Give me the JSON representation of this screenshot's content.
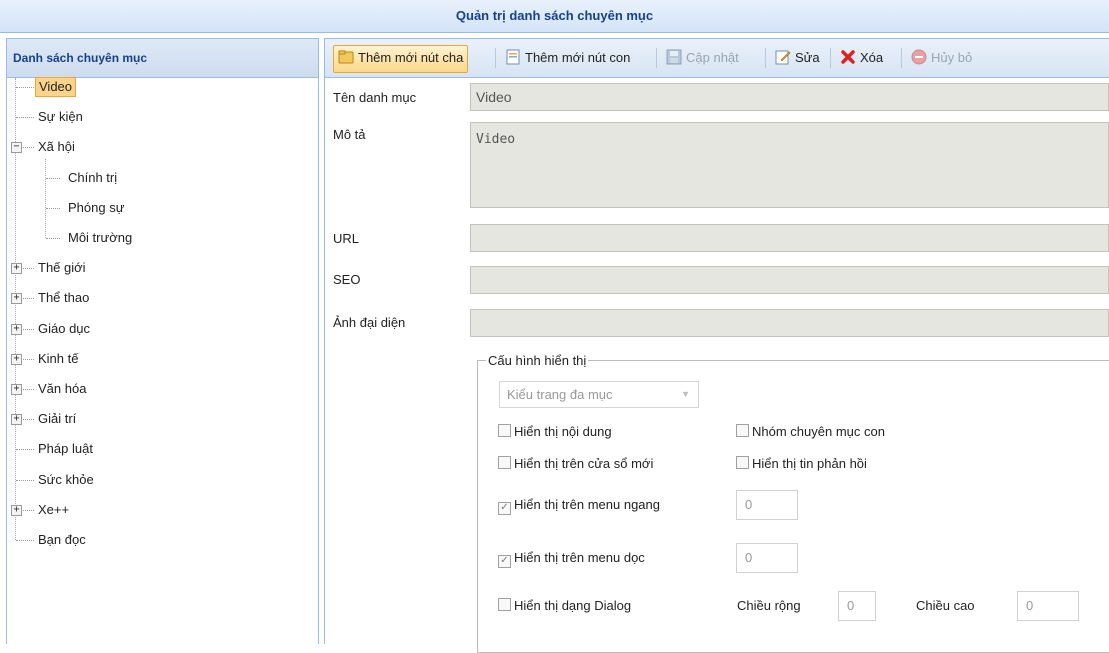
{
  "window_title": "Quản trị danh sách chuyên mục",
  "sidebar": {
    "title": "Danh sách chuyên mục",
    "items": [
      {
        "label": "Video",
        "level": 0,
        "selected": true,
        "expander": "none"
      },
      {
        "label": "Sự kiện",
        "level": 0,
        "expander": "none"
      },
      {
        "label": "Xã hội",
        "level": 0,
        "expander": "collapse"
      },
      {
        "label": "Chính trị",
        "level": 1,
        "expander": "none"
      },
      {
        "label": "Phóng sự",
        "level": 1,
        "expander": "none"
      },
      {
        "label": "Môi trường",
        "level": 1,
        "expander": "none"
      },
      {
        "label": "Thế giới",
        "level": 0,
        "expander": "expand"
      },
      {
        "label": "Thể thao",
        "level": 0,
        "expander": "expand"
      },
      {
        "label": "Giáo dục",
        "level": 0,
        "expander": "expand"
      },
      {
        "label": "Kinh tế",
        "level": 0,
        "expander": "expand"
      },
      {
        "label": "Văn hóa",
        "level": 0,
        "expander": "expand"
      },
      {
        "label": "Giải trí",
        "level": 0,
        "expander": "expand"
      },
      {
        "label": "Pháp luật",
        "level": 0,
        "expander": "none"
      },
      {
        "label": "Sức khỏe",
        "level": 0,
        "expander": "none"
      },
      {
        "label": "Xe++",
        "level": 0,
        "expander": "expand"
      },
      {
        "label": "Bạn đọc",
        "level": 0,
        "expander": "none"
      }
    ]
  },
  "toolbar": {
    "add_parent": "Thêm mới nút cha",
    "add_child": "Thêm mới nút con",
    "update": "Cập nhật",
    "edit": "Sửa",
    "delete": "Xóa",
    "cancel": "Hủy bỏ"
  },
  "form": {
    "name_label": "Tên danh mục",
    "name_value": "Video",
    "desc_label": "Mô tả",
    "desc_value": "Video",
    "url_label": "URL",
    "url_value": "",
    "seo_label": "SEO",
    "seo_value": "",
    "avatar_label": "Ảnh đại diện",
    "avatar_value": ""
  },
  "config": {
    "legend": "Cấu hình hiển thị",
    "page_type": "Kiểu trang đa mục",
    "show_content": "Hiển thị nội dung",
    "child_group": "Nhóm chuyên mục con",
    "new_window": "Hiển thị trên cửa sổ mới",
    "show_feedback": "Hiển thị tin phản hồi",
    "horizontal_menu": "Hiển thị trên menu ngang",
    "horizontal_menu_value": "0",
    "vertical_menu": "Hiển thị trên menu dọc",
    "vertical_menu_value": "0",
    "dialog": "Hiển thị dạng Dialog",
    "width_label": "Chiều rộng",
    "width_value": "0",
    "height_label": "Chiều cao",
    "height_value": "0"
  },
  "colors": {
    "accent": "#15428b",
    "border": "#99bbe8",
    "selected": "#fbd38b"
  }
}
